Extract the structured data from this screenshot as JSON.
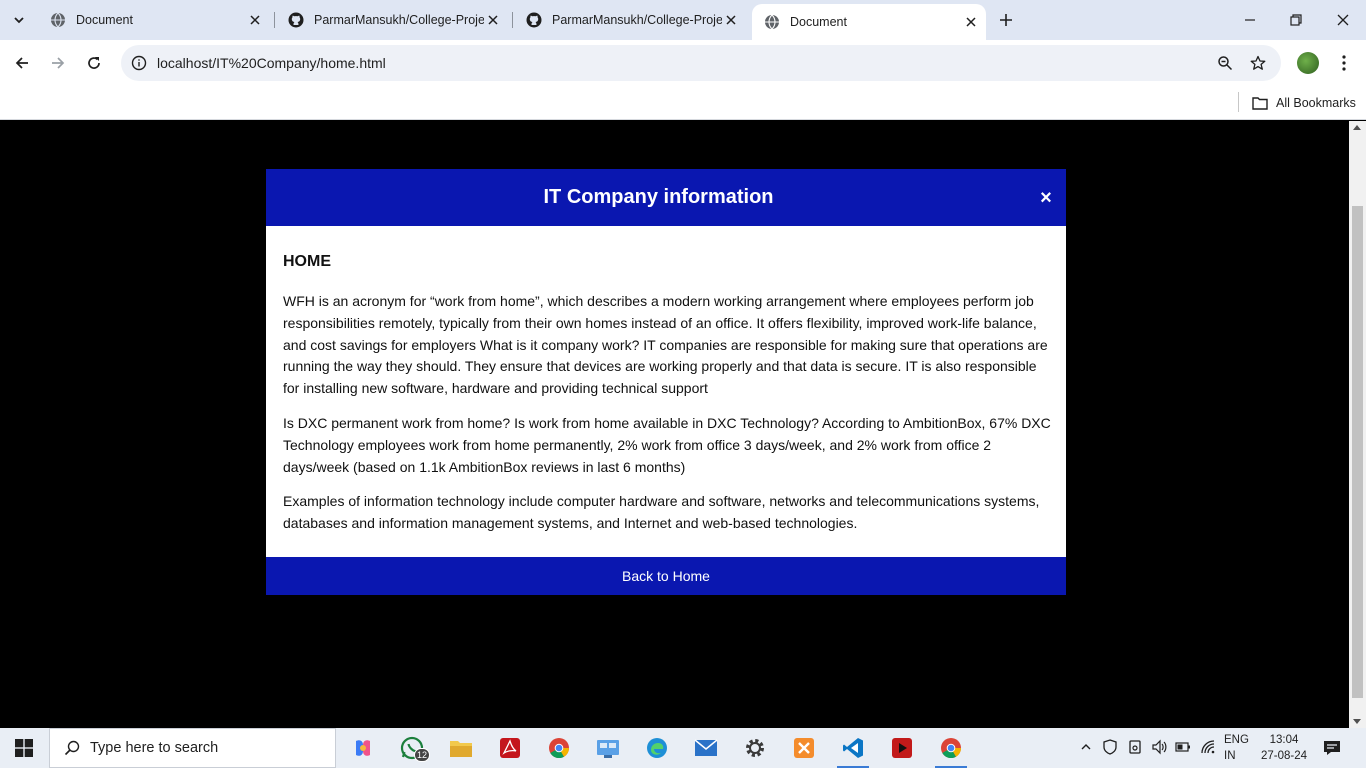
{
  "browser": {
    "tabs": [
      {
        "title": "Document",
        "icon": "globe-icon"
      },
      {
        "title": "ParmarMansukh/College-Projec",
        "icon": "github-icon"
      },
      {
        "title": "ParmarMansukh/College-Projec",
        "icon": "github-icon"
      },
      {
        "title": "Document",
        "icon": "globe-icon",
        "active": true
      }
    ],
    "url": "localhost/IT%20Company/home.html",
    "bookmarks_label": "All Bookmarks"
  },
  "modal": {
    "title": "IT Company information",
    "close_symbol": "×",
    "heading": "HOME",
    "paragraphs": [
      "WFH is an acronym for “work from home”, which describes a modern working arrangement where employees perform job responsibilities remotely, typically from their own homes instead of an office. It offers flexibility, improved work-life balance, and cost savings for employers What is it company work? IT companies are responsible for making sure that operations are running the way they should. They ensure that devices are working properly and that data is secure. IT is also responsible for installing new software, hardware and providing technical support",
      "Is DXC permanent work from home? Is work from home available in DXC Technology? According to AmbitionBox, 67% DXC Technology employees work from home permanently, 2% work from office 3 days/week, and 2% work from office 2 days/week (based on 1.1k AmbitionBox reviews in last 6 months)",
      "Examples of information technology include computer hardware and software, networks and telecommunications systems, databases and information management systems, and Internet and web-based technologies."
    ],
    "footer_button": "Back to Home",
    "header_color": "#0a17b0"
  },
  "taskbar": {
    "search_placeholder": "Type here to search",
    "whatsapp_badge": "12",
    "language": "ENG",
    "region": "IN",
    "time": "13:04",
    "date": "27-08-24"
  }
}
